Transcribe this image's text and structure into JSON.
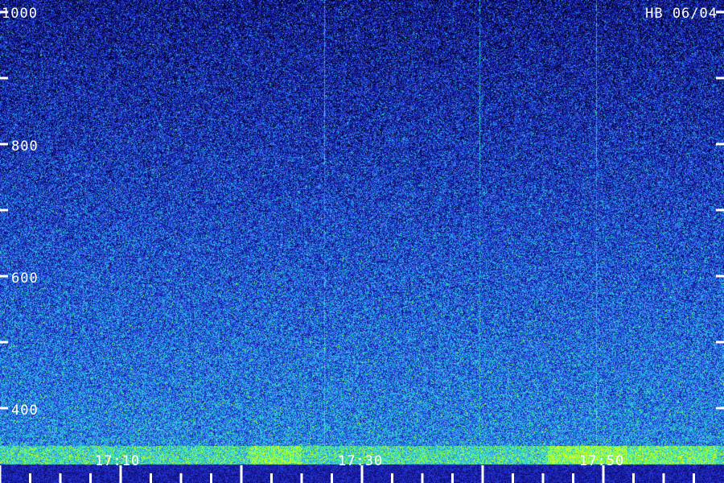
{
  "chart_data": {
    "type": "heatmap",
    "title": "HB 06/04",
    "xlabel": "",
    "ylabel": "",
    "ylim": [
      200,
      1000
    ],
    "y_ticks": [
      400,
      500,
      600,
      700,
      800,
      900,
      1000
    ],
    "y_tick_labels": [
      "400",
      "600",
      "800",
      "1000"
    ],
    "x_tick_labels": [
      "17:10",
      "17:30",
      "17:50"
    ],
    "grid": false,
    "colormap": [
      "#000010",
      "#10108a",
      "#2a3be0",
      "#2aa0f0",
      "#30e0d0",
      "#80ff40",
      "#e0ff20"
    ],
    "features": {
      "vertical_lines_relative_x": [
        0.448,
        0.662,
        0.823
      ],
      "low_frequency_band": "bright green near bottom edge"
    }
  }
}
